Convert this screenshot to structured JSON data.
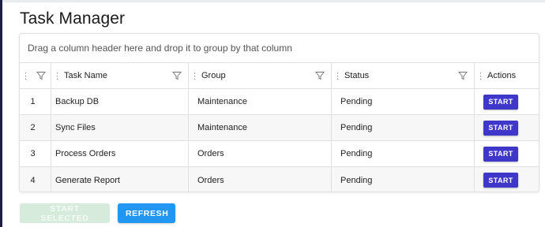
{
  "page": {
    "title": "Task Manager"
  },
  "colors": {
    "accent": "#3f37c9",
    "refresh": "#2196f3",
    "disabled": "#d6ebdc"
  },
  "grid": {
    "group_panel_text": "Drag a column header here and drop it to group by that column",
    "columns": [
      {
        "label": "",
        "has_filter": true
      },
      {
        "label": "Task Name",
        "has_filter": true
      },
      {
        "label": "Group",
        "has_filter": true
      },
      {
        "label": "Status",
        "has_filter": true
      },
      {
        "label": "Actions",
        "has_filter": false
      }
    ],
    "rows": [
      {
        "num": "1",
        "name": "Backup DB",
        "group": "Maintenance",
        "status": "Pending",
        "action": "START"
      },
      {
        "num": "2",
        "name": "Sync Files",
        "group": "Maintenance",
        "status": "Pending",
        "action": "START"
      },
      {
        "num": "3",
        "name": "Process Orders",
        "group": "Orders",
        "status": "Pending",
        "action": "START"
      },
      {
        "num": "4",
        "name": "Generate Report",
        "group": "Orders",
        "status": "Pending",
        "action": "START"
      }
    ]
  },
  "buttons": {
    "start_selected": "START SELECTED",
    "refresh": "REFRESH"
  }
}
